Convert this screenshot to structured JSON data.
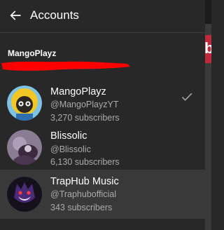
{
  "header": {
    "title": "Accounts"
  },
  "owner": {
    "name": "MangoPlayz"
  },
  "accounts": [
    {
      "name": "MangoPlayz",
      "handle": "@MangoPlayzYT",
      "subscribers": "3,270 subscribers",
      "checked": true
    },
    {
      "name": "Blissolic",
      "handle": "@Blissolic",
      "subscribers": "6,130 subscribers",
      "checked": false
    },
    {
      "name": "TrapHub Music",
      "handle": "@Traphubofficial",
      "subscribers": "343 subscribers",
      "checked": false
    }
  ],
  "colors": {
    "background": "#282828",
    "selected_row": "#393939",
    "secondary_text": "#aaaaaa",
    "redaction": "#ff0000",
    "brand_chip": "#c1293b"
  },
  "icons": {
    "back": "arrow-left-icon",
    "check": "checkmark-icon"
  }
}
